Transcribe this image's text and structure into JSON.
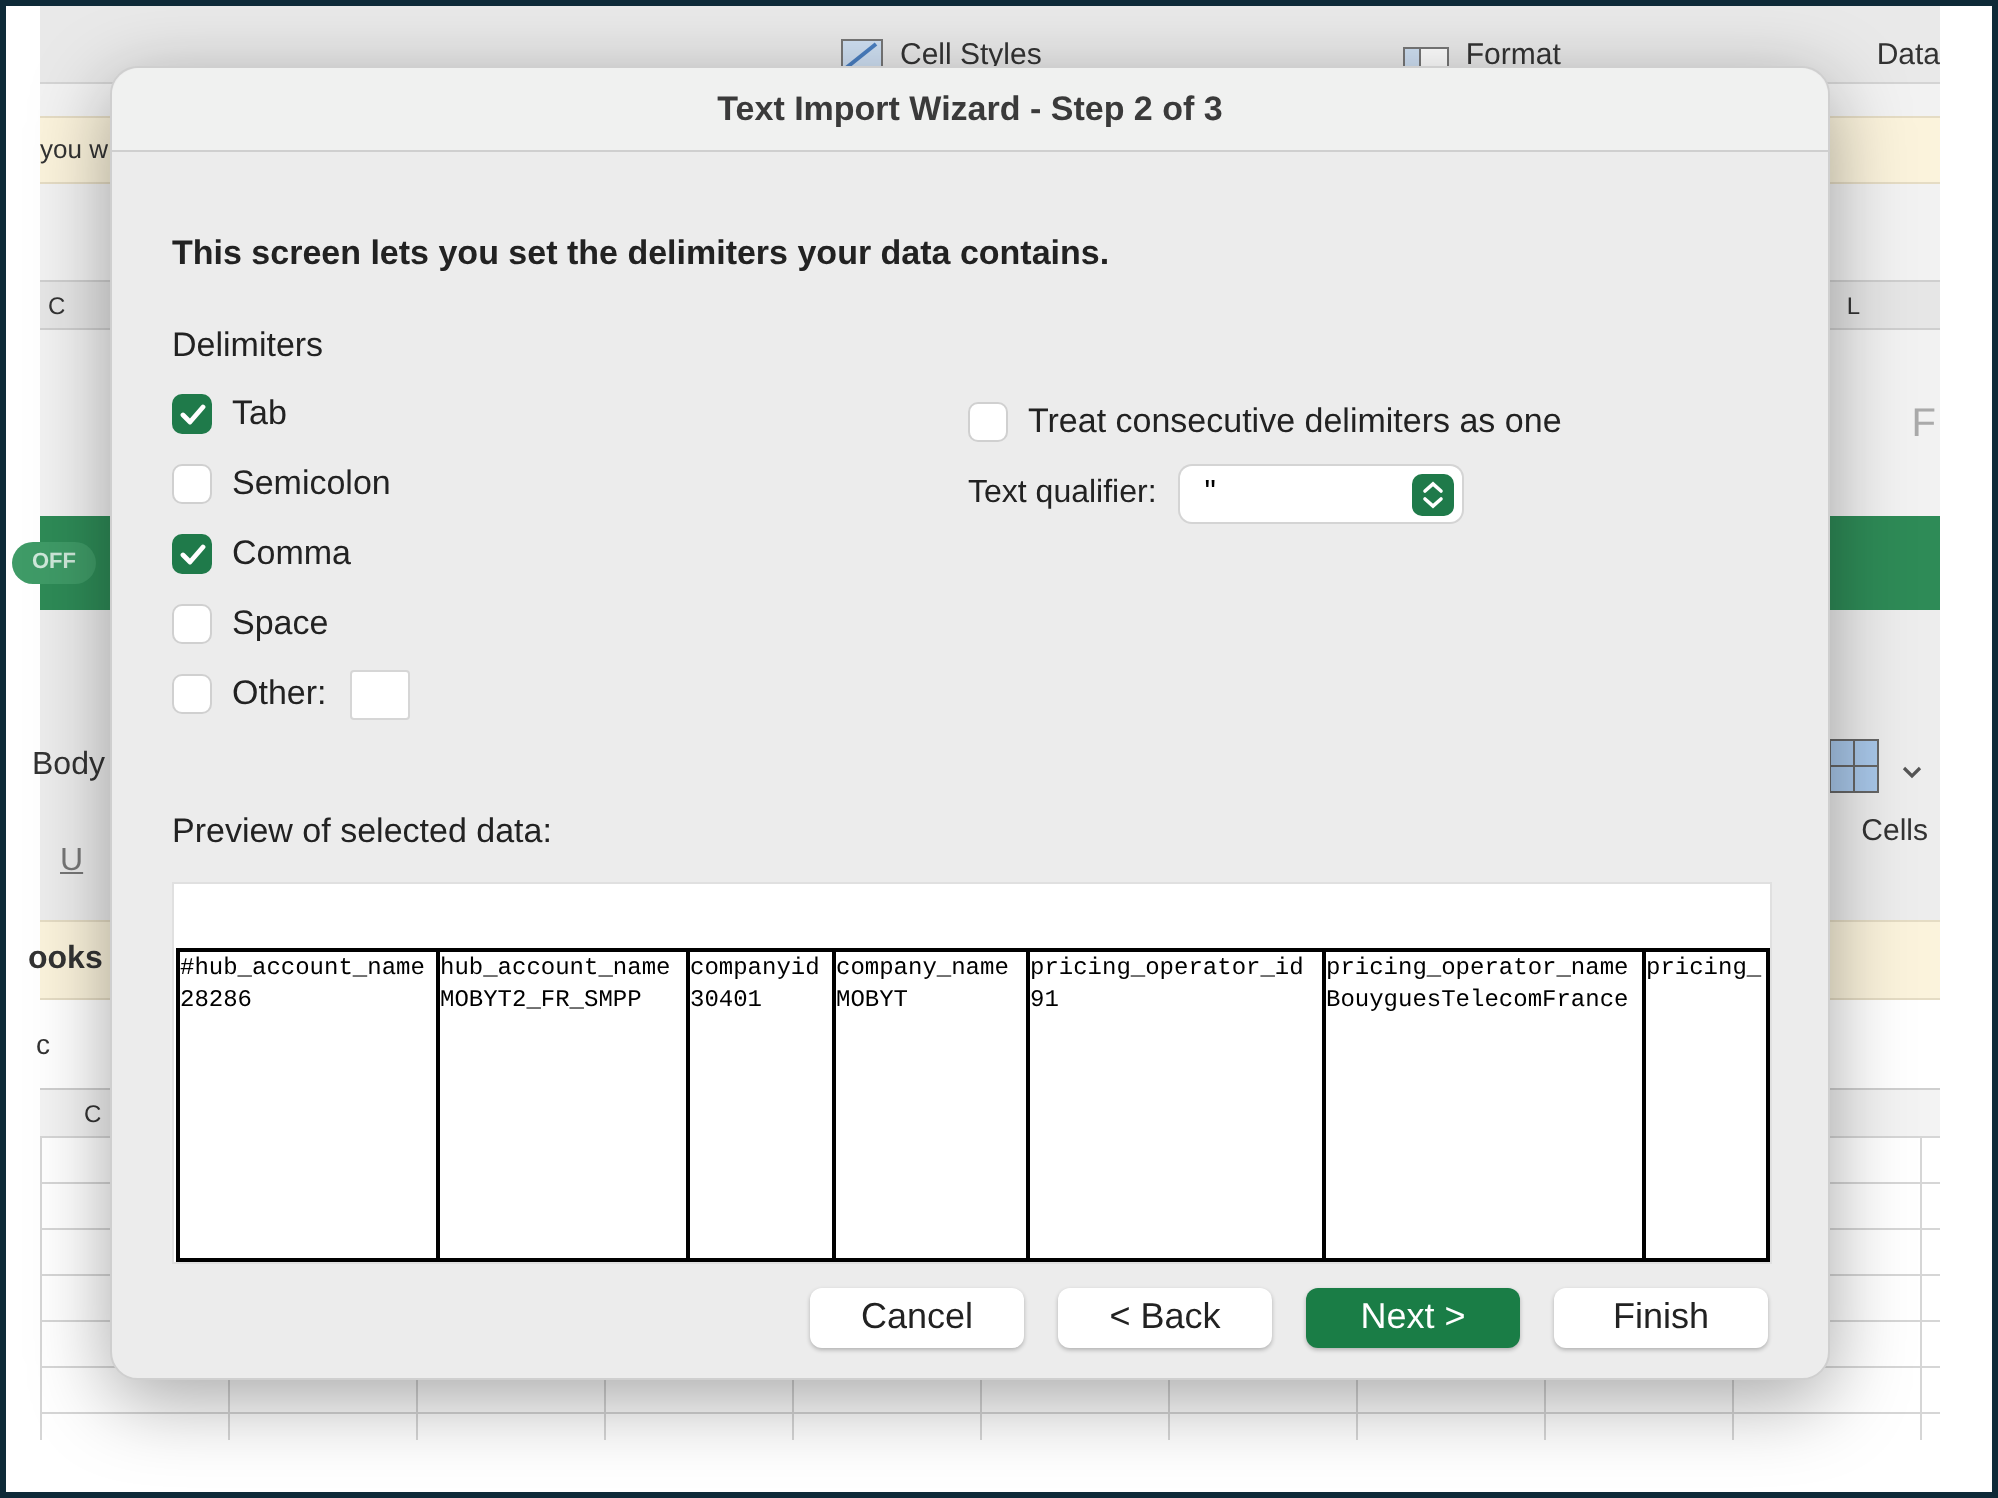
{
  "background": {
    "ribbon_labels": [
      "Cell Styles",
      "Format",
      "Data"
    ],
    "banner_top": "you w",
    "column_header_left": "C",
    "column_header_right": "L",
    "side_letter": "F",
    "toggle": {
      "label": "OFF",
      "on": false
    },
    "font_name": "Body",
    "underline": "U",
    "cells_label": "Cells",
    "banner_bottom": "ooks",
    "formula_fragment": "c",
    "grid_column": "C"
  },
  "dialog": {
    "title": "Text Import Wizard - Step 2 of 3",
    "heading": "This screen lets you set the delimiters your data contains.",
    "delimiters_label": "Delimiters",
    "delimiters": [
      {
        "label": "Tab",
        "checked": true,
        "kind": "checkbox"
      },
      {
        "label": "Semicolon",
        "checked": false,
        "kind": "checkbox"
      },
      {
        "label": "Comma",
        "checked": true,
        "kind": "checkbox"
      },
      {
        "label": "Space",
        "checked": false,
        "kind": "checkbox"
      },
      {
        "label": "Other:",
        "checked": false,
        "kind": "checkbox_with_field"
      }
    ],
    "treat_consecutive": {
      "label": "Treat consecutive delimiters as one",
      "checked": false
    },
    "text_qualifier": {
      "label": "Text qualifier:",
      "value": "\""
    },
    "preview_label": "Preview of selected data:",
    "preview_columns": [
      {
        "header": "#hub_account_name",
        "value": "28286"
      },
      {
        "header": "hub_account_name",
        "value": "MOBYT2_FR_SMPP"
      },
      {
        "header": "companyid",
        "value": "30401"
      },
      {
        "header": "company_name",
        "value": "MOBYT"
      },
      {
        "header": "pricing_operator_id",
        "value": "91"
      },
      {
        "header": "pricing_operator_name",
        "value": "BouyguesTelecomFrance"
      },
      {
        "header": "pricing_"
      }
    ],
    "buttons": [
      {
        "label": "Cancel",
        "primary": false
      },
      {
        "label": "< Back",
        "primary": false
      },
      {
        "label": "Next >",
        "primary": true
      },
      {
        "label": "Finish",
        "primary": false
      }
    ]
  }
}
